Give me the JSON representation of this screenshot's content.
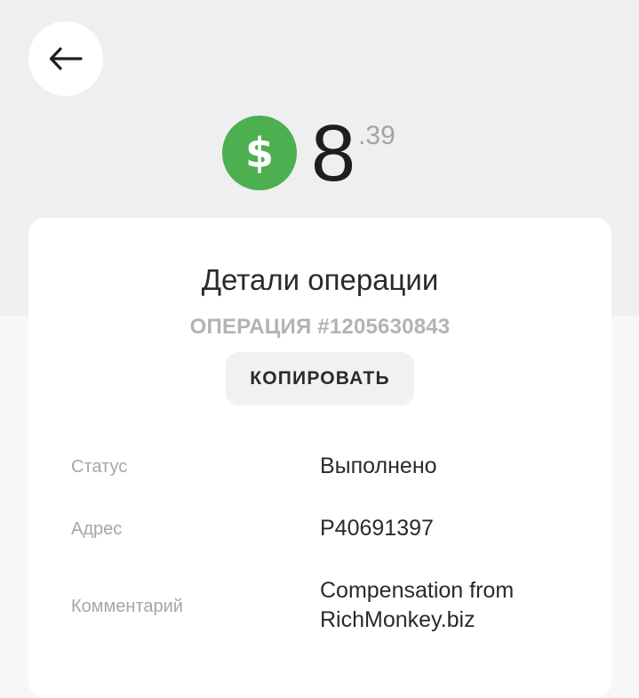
{
  "header": {
    "back_icon": "arrow-left-icon"
  },
  "amount": {
    "currency_icon": "dollar-icon",
    "currency_color": "#4caf50",
    "integer": "8",
    "fraction": ".39"
  },
  "details": {
    "title": "Детали операции",
    "operation_id": "ОПЕРАЦИЯ #1205630843",
    "copy_label": "КОПИРОВАТЬ",
    "rows": [
      {
        "label": "Статус",
        "value": "Выполнено"
      },
      {
        "label": "Адрес",
        "value": "P40691397"
      },
      {
        "label": "Комментарий",
        "value": "Compensation from RichMonkey.biz"
      }
    ]
  }
}
